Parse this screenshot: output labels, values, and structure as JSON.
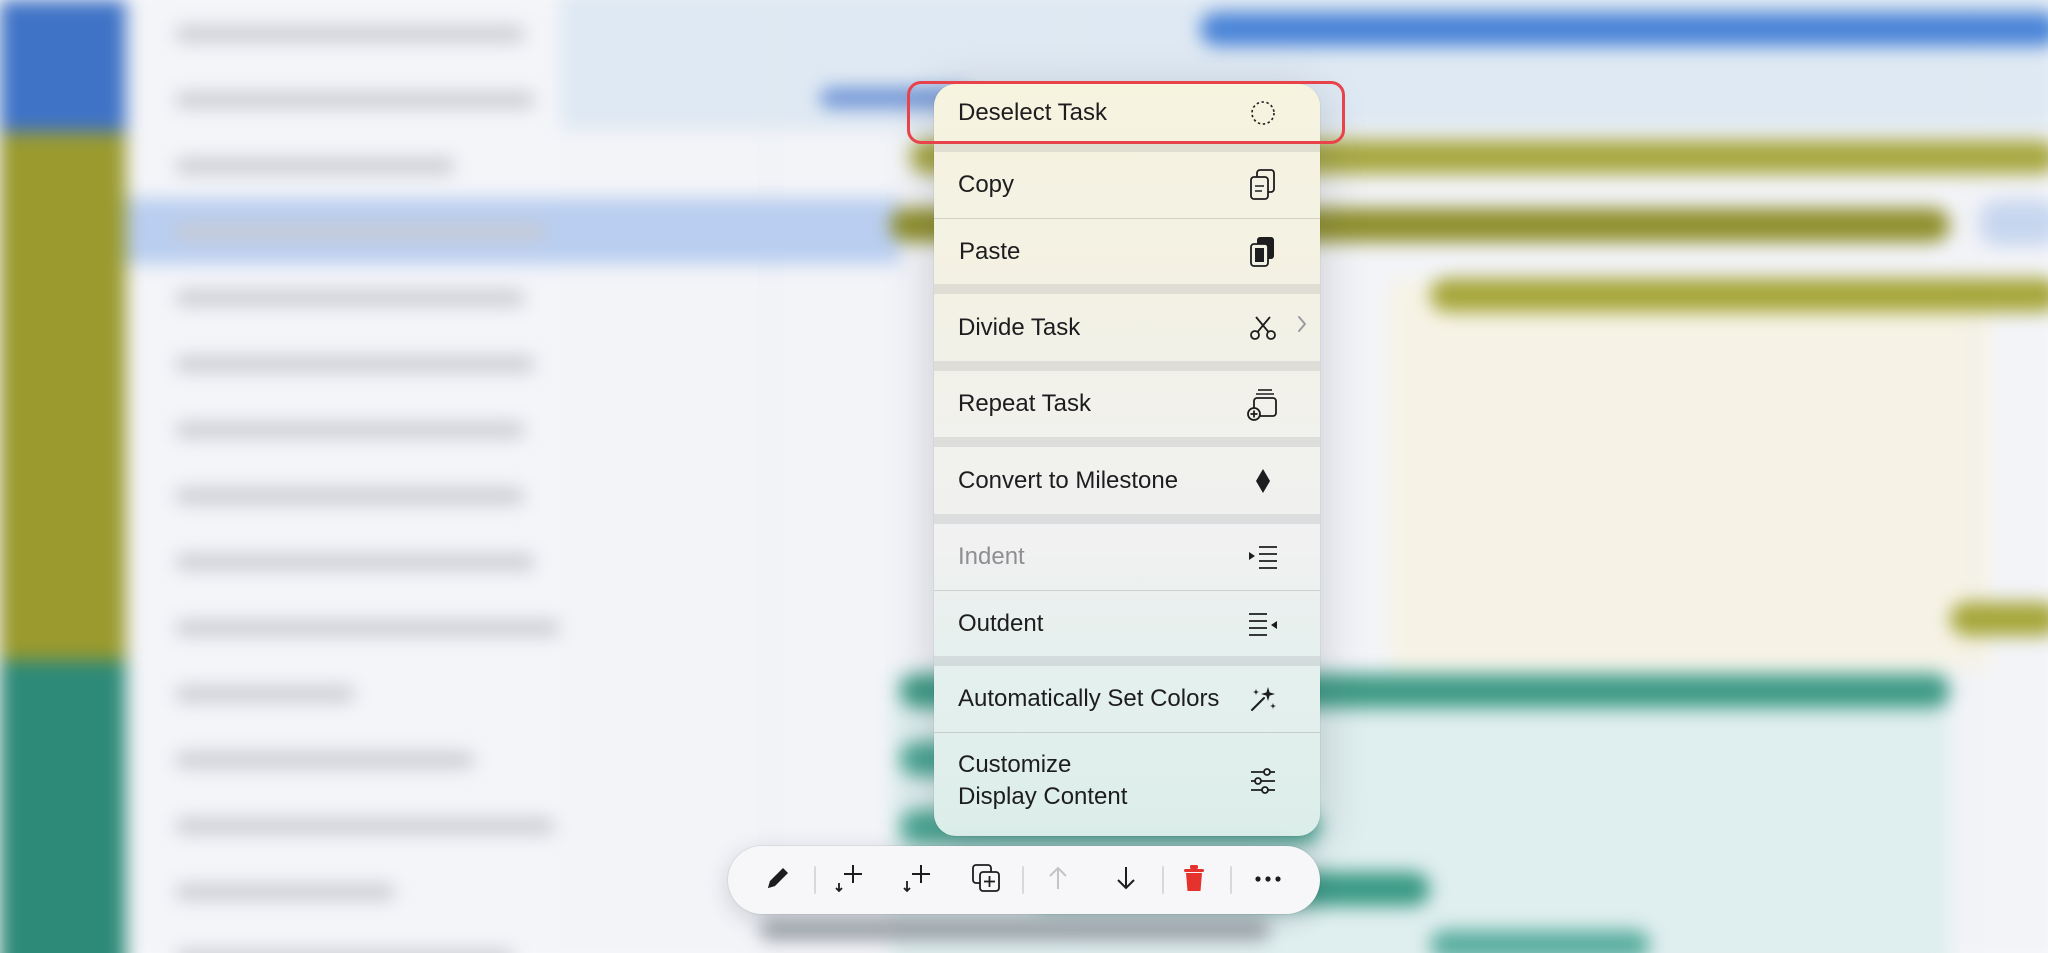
{
  "context_menu": {
    "items": [
      {
        "id": "deselect",
        "label": "Deselect Task",
        "icon": "dashed-circle-icon",
        "enabled": true,
        "highlighted": true
      },
      {
        "id": "copy",
        "label": "Copy",
        "icon": "copy-icon",
        "enabled": true
      },
      {
        "id": "paste",
        "label": "Paste",
        "icon": "paste-icon",
        "enabled": true
      },
      {
        "id": "divide",
        "label": "Divide Task",
        "icon": "scissors-icon",
        "enabled": true,
        "submenu": true
      },
      {
        "id": "repeat",
        "label": "Repeat Task",
        "icon": "repeat-stack-icon",
        "enabled": true
      },
      {
        "id": "milestone",
        "label": "Convert to Milestone",
        "icon": "diamond-icon",
        "enabled": true
      },
      {
        "id": "indent",
        "label": "Indent",
        "icon": "indent-icon",
        "enabled": false
      },
      {
        "id": "outdent",
        "label": "Outdent",
        "icon": "outdent-icon",
        "enabled": true
      },
      {
        "id": "auto_colors",
        "label": "Automatically Set Colors",
        "icon": "sparkles-icon",
        "enabled": true
      },
      {
        "id": "customize",
        "label_line1": "Customize",
        "label_line2": "Display Content",
        "icon": "sliders-icon",
        "enabled": true
      }
    ],
    "highlight_color": "#e8434b"
  },
  "toolbar": {
    "buttons": [
      {
        "id": "edit",
        "icon": "pencil-icon",
        "enabled": true
      },
      {
        "id": "insert_above",
        "icon": "insert-above-icon",
        "enabled": true
      },
      {
        "id": "insert_below",
        "icon": "insert-below-icon",
        "enabled": true
      },
      {
        "id": "duplicate",
        "icon": "duplicate-icon",
        "enabled": true
      },
      {
        "id": "move_up",
        "icon": "arrow-up-icon",
        "enabled": false
      },
      {
        "id": "move_down",
        "icon": "arrow-down-icon",
        "enabled": true
      },
      {
        "id": "delete",
        "icon": "trash-icon",
        "enabled": true,
        "color": "#e5322d"
      },
      {
        "id": "more",
        "icon": "ellipsis-icon",
        "enabled": true
      }
    ]
  },
  "background": {
    "row_colors": [
      "#3f73c6",
      "#3f73c6",
      "#9a9a2e",
      "#9a9a2e",
      "#9a9a2e",
      "#9a9a2e",
      "#9a9a2e",
      "#9a9a2e",
      "#9a9a2e",
      "#9a9a2e",
      "#2e8a78",
      "#2e8a78",
      "#2e8a78",
      "#2e8a78",
      "#2e8a78"
    ],
    "selected_row_color": "#b9cef0"
  }
}
